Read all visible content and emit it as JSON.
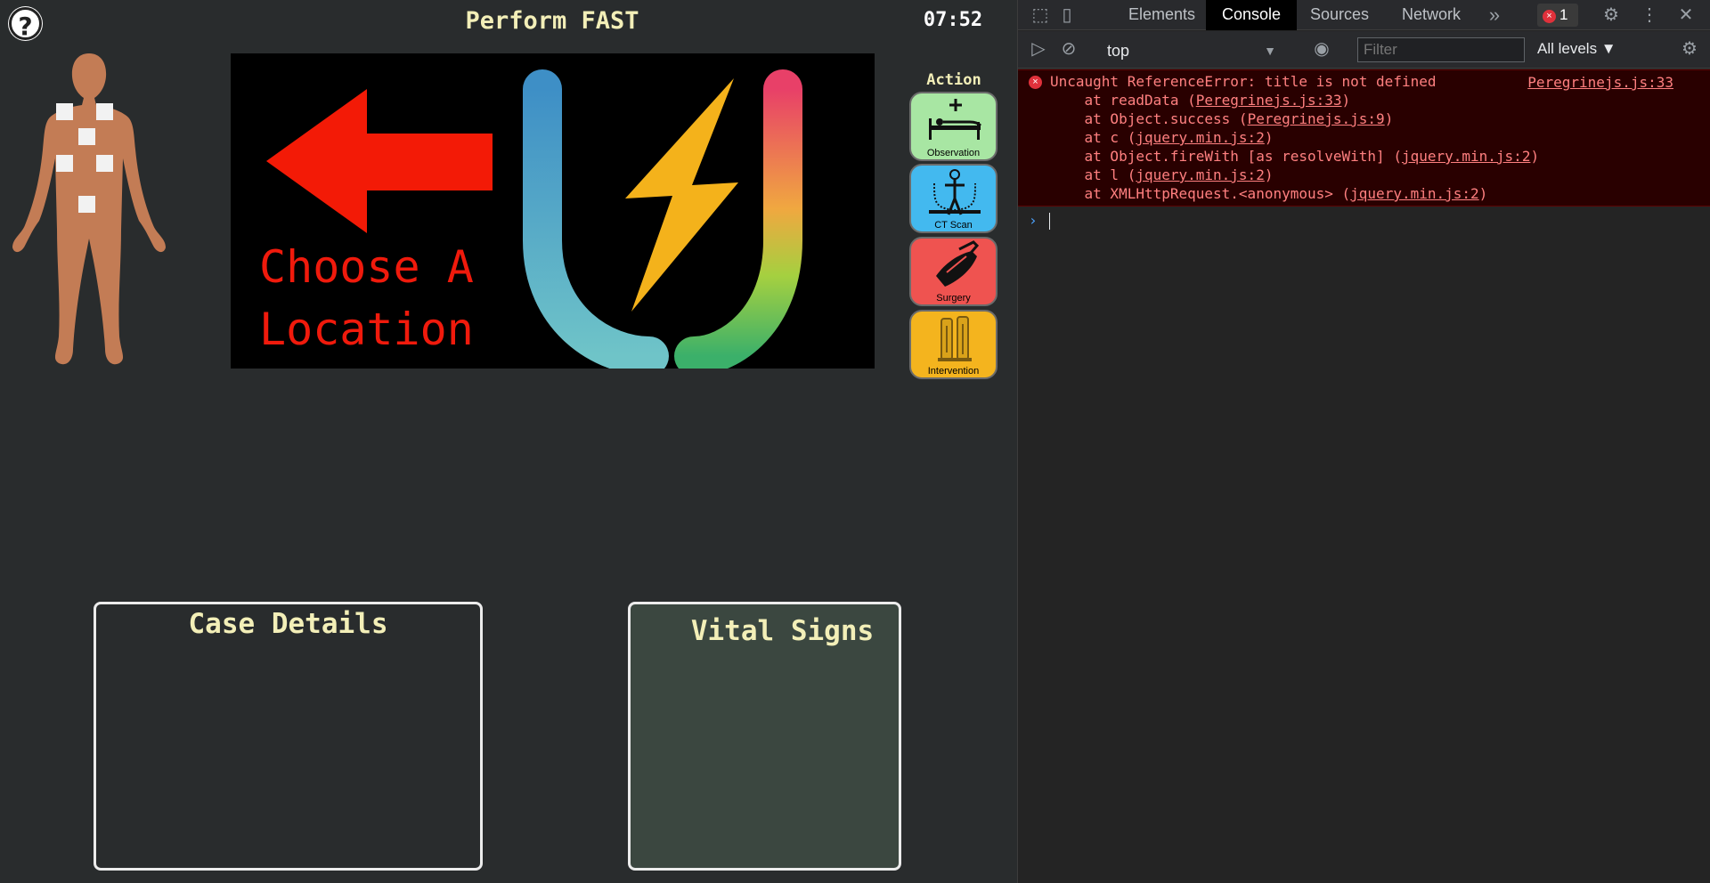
{
  "app": {
    "help_label": "?",
    "title": "Perform FAST",
    "clock": "07:52",
    "panel": {
      "choose_line1": "Choose A",
      "choose_line2": "Location"
    },
    "action": {
      "heading": "Action",
      "buttons": [
        {
          "label": "Observation",
          "color": "#a8e6a3"
        },
        {
          "label": "CT Scan",
          "color": "#43b9ef"
        },
        {
          "label": "Surgery",
          "color": "#ef5350"
        },
        {
          "label": "Intervention",
          "color": "#f4b41e"
        }
      ]
    },
    "case_details": {
      "title": "Case Details"
    },
    "vital_signs": {
      "title": "Vital Signs"
    }
  },
  "devtools": {
    "tabs": [
      "Elements",
      "Console",
      "Sources",
      "Network"
    ],
    "active_tab": "Console",
    "more_tabs": "»",
    "error_count": "1",
    "context": "top",
    "filter_placeholder": "Filter",
    "levels": "All levels ▼",
    "error": {
      "message": "Uncaught ReferenceError: title is not defined",
      "source": "Peregrinejs.js:33",
      "stack": [
        {
          "pre": "    at readData (",
          "link": "Peregrinejs.js:33",
          "post": ")"
        },
        {
          "pre": "    at Object.success (",
          "link": "Peregrinejs.js:9",
          "post": ")"
        },
        {
          "pre": "    at c (",
          "link": "jquery.min.js:2",
          "post": ")"
        },
        {
          "pre": "    at Object.fireWith [as resolveWith] (",
          "link": "jquery.min.js:2",
          "post": ")"
        },
        {
          "pre": "    at l (",
          "link": "jquery.min.js:2",
          "post": ")"
        },
        {
          "pre": "    at XMLHttpRequest.<anonymous> (",
          "link": "jquery.min.js:2",
          "post": ")"
        }
      ]
    },
    "prompt": "›"
  }
}
